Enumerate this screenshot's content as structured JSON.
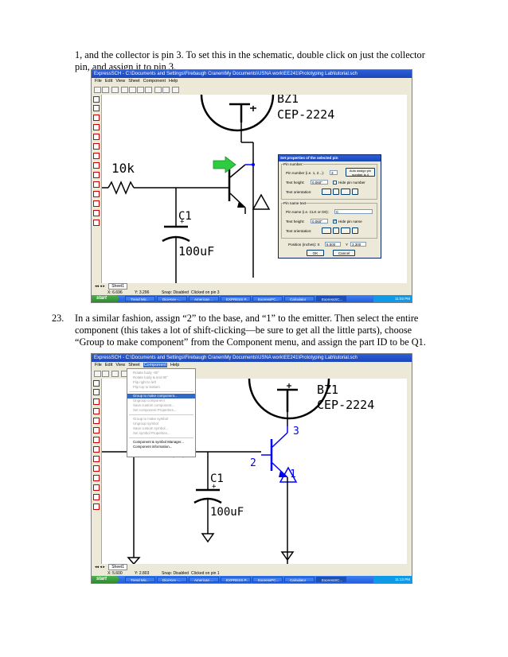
{
  "text": {
    "para1_line1": "1, and the collector is pin 3.  To set this in the schematic, double click on just the collector",
    "para1_line2": "pin, and assign it to pin 3.",
    "para2_num": "23.",
    "para2_line1": "In a similar fashion, assign “2” to the base, and “1” to the emitter.  Then select the entire",
    "para2_line2": "component (this takes a lot of shift-clicking—be sure to get all the little parts), choose",
    "para2_line3": "“Group to make component” from the Component menu, and assign the part ID to be Q1."
  },
  "screenshot1": {
    "window_title": "ExpressSCH - C:\\Documents and Settings\\Firebaugh Cranen\\My Documents\\USNA work\\EE241\\Prototyping Lab\\tutorial.sch",
    "menus": [
      "File",
      "Edit",
      "View",
      "Sheet",
      "Component",
      "Help"
    ],
    "labels": {
      "part": "BZ1",
      "part_number": "CEP-2224",
      "resistor": "10k",
      "cap_ref": "C1",
      "cap_value": "100uF",
      "plus": "+"
    },
    "dialog": {
      "title": "Set properties of the selected pin",
      "group1": "Pin number:",
      "pin_number_label": "Pin number (i.e.  1, 2...):",
      "pin_number_value": "3",
      "auto_assign": "Auto assign pin number is 4",
      "text_height_label": "Text height:",
      "text_height_value": "0.060\"",
      "hide_pin_number": "Hide pin number",
      "text_orientation_label": "Text orientation:",
      "group2": "Pin name text",
      "pin_name_label": "Pin name (i.e. CLK or D0):",
      "pin_name_value": "C",
      "text_height_value2": "0.060\"",
      "hide_pin_name": "Hide pin name",
      "position_label": "Position (inches):  X",
      "pos_x": "6.500",
      "pos_y_label": "Y",
      "pos_y": "3.300",
      "ok": "OK",
      "cancel": "Cancel"
    },
    "sheet_tab": "Sheet1",
    "status": {
      "x": "X: 6.696",
      "y": "Y: 3.296",
      "snap": "Snap: Disabled",
      "msg": "Clicked on pin 3"
    },
    "taskbar": {
      "start": "start",
      "items": [
        "Trend Mic...",
        "Digi-Key -...",
        "American ...",
        "EXPRESS P...",
        "ExpressPC...",
        "Calculator",
        "ExpressSC..."
      ],
      "clock": "11:03 PM"
    }
  },
  "screenshot2": {
    "window_title": "ExpressSCH - C:\\Documents and Settings\\Firebaugh Cranen\\My Documents\\USNA work\\EE241\\Prototyping Lab\\tutorial.sch",
    "menus": [
      "File",
      "Edit",
      "View",
      "Sheet",
      "Component",
      "Help"
    ],
    "labels": {
      "part": "BZ1",
      "part_number": "CEP-2224",
      "cap_ref": "C1",
      "cap_value": "100uF",
      "pin3": "3",
      "pin2": "2",
      "pin1": "1",
      "plus": "+"
    },
    "component_menu": [
      "Rotate body -90°",
      "Rotate body & text 90°",
      "Flip right to left",
      "Flip top to bottom",
      "Group to make component...",
      "Ungroup component",
      "Save custom component...",
      "Set component Properties...",
      "Group to make symbol",
      "Ungroup symbol",
      "Save custom symbol...",
      "Set symbol Properties...",
      "Component & symbol Manager...",
      "Component information..."
    ],
    "sheet_tab": "Sheet1",
    "status": {
      "x": "X: 5.600",
      "y": "Y: 2.803",
      "snap": "Snap: Disabled",
      "msg": "Clicked on pin 1"
    },
    "taskbar": {
      "start": "start",
      "items": [
        "Trend Mic...",
        "Digi-Key -...",
        "American ...",
        "EXPRESS P...",
        "ExpressPC...",
        "Calculator",
        "ExpressSC..."
      ],
      "clock": "11:13 PM"
    }
  }
}
